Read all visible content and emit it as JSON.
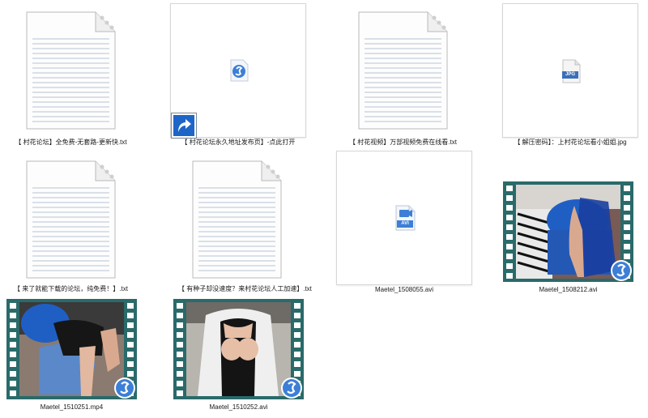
{
  "files": [
    {
      "id": "f1",
      "name": "【 村花论坛】全免费-无套路-更新快.txt",
      "kind": "txt"
    },
    {
      "id": "f2",
      "name": "【 村花论坛永久地址发布页】-点此打开",
      "kind": "shortcut"
    },
    {
      "id": "f3",
      "name": "【 村花视频】万部视频免费在线看.txt",
      "kind": "txt"
    },
    {
      "id": "f4",
      "name": "【 解压密码】：上村花论坛看小姐姐.jpg",
      "kind": "jpg",
      "badge": "JPG"
    },
    {
      "id": "f5",
      "name": "【 来了就能下载的论坛，纯免费！】.txt",
      "kind": "txt"
    },
    {
      "id": "f6",
      "name": "【 有种子却没速度？来村花论坛人工加速】.txt",
      "kind": "txt"
    },
    {
      "id": "f7",
      "name": "Maetel_1508055.avi",
      "kind": "avi",
      "badge": "AVI"
    },
    {
      "id": "f8",
      "name": "Maetel_1508212.avi",
      "kind": "video"
    },
    {
      "id": "f9",
      "name": "Maetel_1510251.mp4",
      "kind": "video"
    },
    {
      "id": "f10",
      "name": "Maetel_1510252.avi",
      "kind": "video"
    }
  ],
  "colors": {
    "accent": "#3d7fd6",
    "film": "#2a6a6a",
    "blue_chair": "#1f5fc4"
  },
  "icons": {
    "txt": "text-document-icon",
    "shortcut": "shortcut-arrow-icon",
    "app": "app-logo-icon",
    "jpg": "jpg-file-icon",
    "avi": "avi-file-icon",
    "player": "player-badge-icon"
  }
}
